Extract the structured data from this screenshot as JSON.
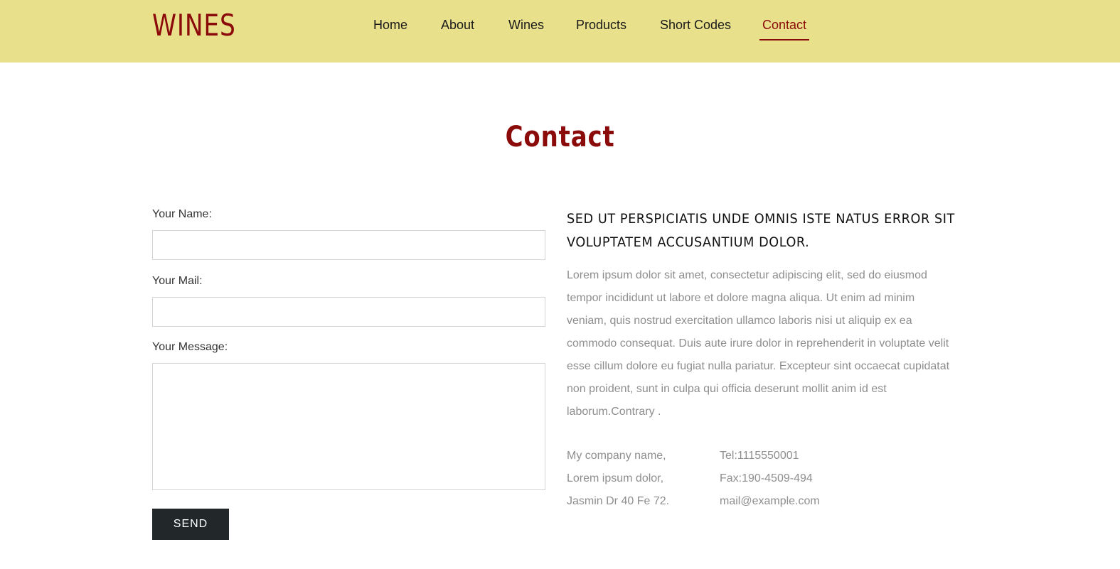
{
  "header": {
    "logo": "WINES",
    "nav": [
      {
        "label": "Home"
      },
      {
        "label": "About"
      },
      {
        "label": "Wines"
      },
      {
        "label": "Products"
      },
      {
        "label": "Short Codes"
      },
      {
        "label": "Contact",
        "active": true
      }
    ]
  },
  "page": {
    "title": "Contact"
  },
  "form": {
    "name_label": "Your Name:",
    "name_value": "",
    "mail_label": "Your Mail:",
    "mail_value": "",
    "message_label": "Your Message:",
    "message_value": "",
    "send_label": "SEND"
  },
  "info": {
    "heading_line1": "SED UT PERSPICIATIS UNDE OMNIS ISTE NATUS ERROR SIT",
    "heading_line2": "VOLUPTATEM ACCUSANTIUM DOLOR.",
    "paragraph": "Lorem ipsum dolor sit amet, consectetur adipiscing elit, sed do eiusmod tempor incididunt ut labore et dolore magna aliqua. Ut enim ad minim veniam, quis nostrud exercitation ullamco laboris nisi ut aliquip ex ea commodo consequat. Duis aute irure dolor in reprehenderit in voluptate velit esse cillum dolore eu fugiat nulla pariatur. Excepteur sint occaecat cupidatat non proident, sunt in culpa qui officia deserunt mollit anim id est laborum.Contrary .",
    "address": [
      "My company name,",
      "Lorem ipsum dolor,",
      "Jasmin Dr 40 Fe 72."
    ],
    "contact": [
      "Tel:1115550001",
      "Fax:190-4509-494",
      "mail@example.com"
    ]
  },
  "colors": {
    "header_bg": "#e9e08c",
    "accent": "#8b0a0a",
    "button_bg": "#22272a",
    "muted_text": "#8e8e8e"
  }
}
